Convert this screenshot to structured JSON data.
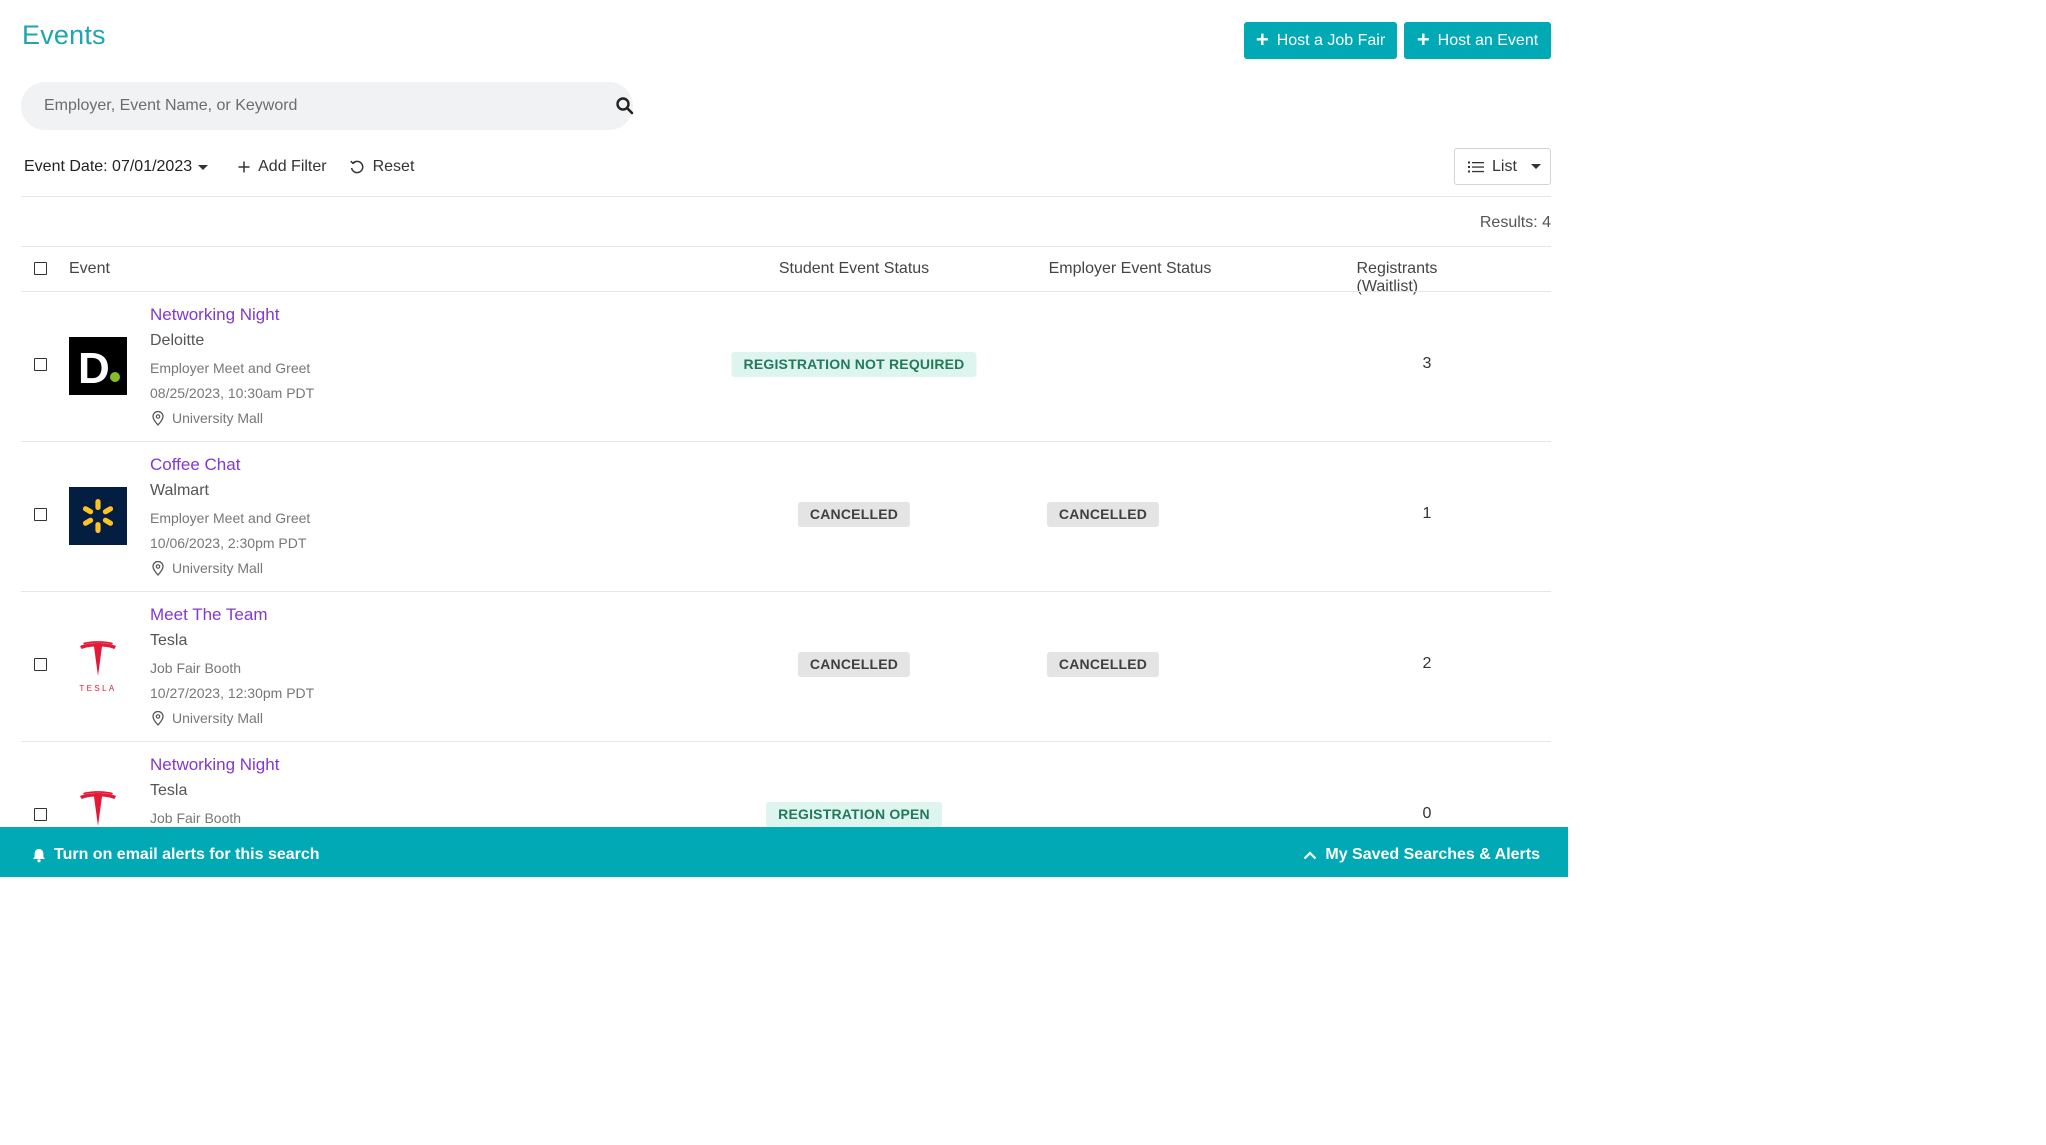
{
  "page": {
    "title": "Events"
  },
  "header_buttons": {
    "job_fair": "Host a Job Fair",
    "event": "Host an Event"
  },
  "search": {
    "placeholder": "Employer, Event Name, or Keyword",
    "value": ""
  },
  "filters": {
    "event_date": "Event Date: 07/01/2023",
    "add_filter": "Add Filter",
    "reset": "Reset"
  },
  "view": {
    "selected": "List"
  },
  "results": {
    "label": "Results: 4"
  },
  "table": {
    "headers": {
      "event": "Event",
      "student_status": "Student Event Status",
      "employer_status": "Employer Event Status",
      "registrants": "Registrants (Waitlist)"
    },
    "rows": [
      {
        "title": "Networking Night",
        "employer": "Deloitte",
        "type": "Employer Meet and Greet",
        "date": "08/25/2023, 10:30am PDT",
        "location": "University Mall",
        "student_status": "REGISTRATION NOT REQUIRED",
        "employer_status": "",
        "registrants": "3",
        "logo": "deloitte-logo"
      },
      {
        "title": "Coffee Chat",
        "employer": "Walmart",
        "type": "Employer Meet and Greet",
        "date": "10/06/2023, 2:30pm PDT",
        "location": "University Mall",
        "student_status": "CANCELLED",
        "employer_status": "CANCELLED",
        "registrants": "1",
        "logo": "walmart-logo"
      },
      {
        "title": "Meet The Team",
        "employer": "Tesla",
        "type": "Job Fair Booth",
        "date": "10/27/2023, 12:30pm PDT",
        "location": "University Mall",
        "student_status": "CANCELLED",
        "employer_status": "CANCELLED",
        "registrants": "2",
        "logo": "tesla-logo"
      },
      {
        "title": "Networking Night",
        "employer": "Tesla",
        "type": "Job Fair Booth",
        "student_status": "REGISTRATION OPEN",
        "employer_status": "",
        "registrants": "0",
        "logo": "tesla-logo"
      }
    ]
  },
  "logos": {
    "deloitte_letter": "D",
    "tesla_wordmark": "TESLA"
  },
  "footer": {
    "alerts": "Turn on email alerts for this search",
    "saved": "My Saved Searches & Alerts"
  },
  "colors": {
    "brand_teal": "#00a9b4",
    "title_teal": "#1da5b2",
    "link_purple": "#8338ce"
  }
}
